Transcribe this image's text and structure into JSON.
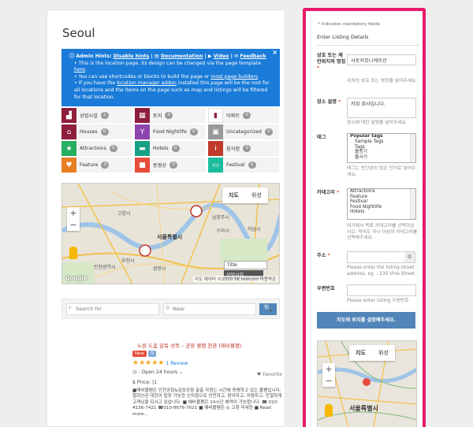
{
  "left": {
    "title": "Seoul",
    "hints": {
      "close": "×",
      "header_prefix": "Admin Hints:",
      "disable": "Disable hints",
      "documentation": "Documentation",
      "video": "Video",
      "feedback": "Feedback",
      "line1_a": "This is the location page, its design can be changed via the page template",
      "line1_link": "here",
      "line2_a": "You can use shortcodes or blocks to build the page or",
      "line2_link": "most page builders",
      "line3_a": "If you have the",
      "line3_link": "location manager addon",
      "line3_b": "installed this page will be the root for all locations and the items on the page such as map and listings will be filtered for that location."
    },
    "categories": [
      {
        "label": "상업시설",
        "count": "2",
        "color": "#8e1e3c",
        "icon": "factory-icon",
        "glyph": "▟"
      },
      {
        "label": "토지",
        "count": "0",
        "color": "#8e1e3c",
        "icon": "map-icon",
        "glyph": "▦"
      },
      {
        "label": "아파트",
        "count": "0",
        "color": "#ffffff",
        "icon": "building-icon",
        "glyph": "▮"
      },
      {
        "label": "Houses",
        "count": "0",
        "color": "#8e1e3c",
        "icon": "house-icon",
        "glyph": "⌂"
      },
      {
        "label": "Food Nightlife",
        "count": "0",
        "color": "#8e44ad",
        "icon": "cocktail-icon",
        "glyph": "Y"
      },
      {
        "label": "Uncategorized",
        "count": "0",
        "color": "#999999",
        "icon": "photo-icon",
        "glyph": "▣"
      },
      {
        "label": "Attractions",
        "count": "0",
        "color": "#27ae60",
        "icon": "star-icon",
        "glyph": "★"
      },
      {
        "label": "Hotels",
        "count": "0",
        "color": "#16a085",
        "icon": "bed-icon",
        "glyph": "▬"
      },
      {
        "label": "음식점",
        "count": "0",
        "color": "#c0392b",
        "icon": "utensils-icon",
        "glyph": "ɨ"
      },
      {
        "label": "Feature",
        "count": "0",
        "color": "#e67e22",
        "icon": "heart-icon",
        "glyph": "♥"
      },
      {
        "label": "동영상",
        "count": "0",
        "color": "#e74c3c",
        "icon": "video-icon",
        "glyph": "■"
      },
      {
        "label": "Festival",
        "count": "0",
        "color": "#1abc9c",
        "icon": "ticket-icon",
        "glyph": "▭"
      }
    ],
    "map": {
      "toggle_map": "지도",
      "toggle_sat": "위성",
      "zoom_in": "+",
      "zoom_out": "−",
      "labels": [
        "고양시",
        "남양주시",
        "서울특별시",
        "부천시",
        "인천광역시",
        "광명시",
        "하남시",
        "구리시"
      ],
      "popup_title": "Title",
      "popup_label": "상업시설",
      "credit": "지도 데이터 ©2020 SK telecom  이용약관",
      "logo": "Google"
    },
    "search": {
      "placeholder": "Search for",
      "near": "Near",
      "button": "🔍"
    },
    "listing": {
      "title": "노원 도움 감독 성북 – 공항 볼펜 찬픈 (매비볼펜)",
      "new_badge": "New",
      "rating_stars": "★★★★★",
      "rating": 5,
      "reviews": "1 Review",
      "favorite": "Favorite",
      "open": ": Open 24 hours",
      "price": "$ Price: |1",
      "excerpt": "■매비볼펜은 인천공항&김포공항 출출 자원는 시간에 증평하고 있는 볼펜입니다. 협회산균 대한이 탑장 가능한 신자형으로 안전하고, 편리하고, 저렴하고, 친절하게 고객님을 되시고 있습니다. ■ 예비볼펜은 24시간 예약이 가능합니다. ☎ 010-4136-7421 ☎010-8676-7621 ■ 예비볼펜은 ◎ 고향 미세한 ■ Read more..."
    }
  },
  "form": {
    "mandatory_note": "* Indicates mandatory fields",
    "legend": "Enter Listing Details",
    "title_label": "상호 또는 제안위치의 명칭",
    "title_value": "사토커뮤니케이션",
    "title_desc": "위치의 상호 또는 명칭을 넣어주세요",
    "desc_label": "장소 설명",
    "desc_value": "저희 회사입니다.",
    "desc_desc": "장소에 대한 설명을 넣어주세요",
    "tags_label": "태그",
    "tags_group": "Popular tags",
    "tags_options": [
      "Sample Tags",
      "Tags",
      "볼링기",
      "볼사기"
    ],
    "tags_desc": "태그는 반칸없이 잡은 단어로 넣어주세요.",
    "category_label": "카테고리",
    "category_options": [
      "Attractions",
      "Feature",
      "Festival",
      "Food Nightlife",
      "Hotels"
    ],
    "category_desc": "여기에서 목록 카테고리를 선택하십시오. 적어도 하나 이상의 카테고리를 선택해주세요.",
    "address_label": "주소",
    "address_desc": "Please enter the listing street address. eg. : 230 Vine Street",
    "postcode_label": "우편번호",
    "postcode_desc": "Please enter listing 우편번호",
    "geo_button": "지도에 위치를 설정해주세요.",
    "map_toggle_map": "지도",
    "map_toggle_sat": "위성",
    "map_label": "서울특별시"
  },
  "colors": {
    "highlight_border": "#e8196a",
    "hint_bg": "#1a7bd8",
    "button_blue": "#5285b8"
  }
}
